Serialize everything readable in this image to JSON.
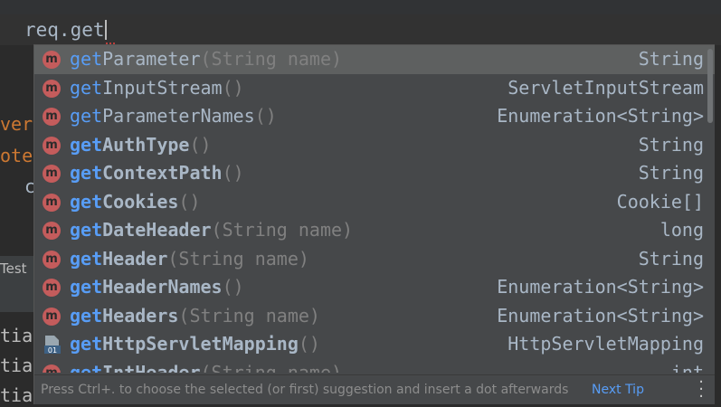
{
  "editor": {
    "code_line": "req.get"
  },
  "background_fragments": [
    "ver",
    "ote",
    "c",
    "Test",
    "tia",
    "tia",
    "tia"
  ],
  "completion": {
    "items": [
      {
        "prefix": "get",
        "rest": "Parameter",
        "params": "(String name)",
        "type": "String",
        "icon": "method-icon",
        "bold": false,
        "selected": true
      },
      {
        "prefix": "get",
        "rest": "InputStream",
        "params": "()",
        "type": "ServletInputStream",
        "icon": "method-icon",
        "bold": false,
        "selected": false
      },
      {
        "prefix": "get",
        "rest": "ParameterNames",
        "params": "()",
        "type": "Enumeration<String>",
        "icon": "method-icon",
        "bold": false,
        "selected": false
      },
      {
        "prefix": "get",
        "rest": "AuthType",
        "params": "()",
        "type": "String",
        "icon": "method-icon",
        "bold": true,
        "selected": false
      },
      {
        "prefix": "get",
        "rest": "ContextPath",
        "params": "()",
        "type": "String",
        "icon": "method-icon",
        "bold": true,
        "selected": false
      },
      {
        "prefix": "get",
        "rest": "Cookies",
        "params": "()",
        "type": "Cookie[]",
        "icon": "method-icon",
        "bold": true,
        "selected": false
      },
      {
        "prefix": "get",
        "rest": "DateHeader",
        "params": "(String name)",
        "type": "long",
        "icon": "method-icon",
        "bold": true,
        "selected": false
      },
      {
        "prefix": "get",
        "rest": "Header",
        "params": "(String name)",
        "type": "String",
        "icon": "method-icon",
        "bold": true,
        "selected": false
      },
      {
        "prefix": "get",
        "rest": "HeaderNames",
        "params": "()",
        "type": "Enumeration<String>",
        "icon": "method-icon",
        "bold": true,
        "selected": false
      },
      {
        "prefix": "get",
        "rest": "Headers",
        "params": "(String name)",
        "type": "Enumeration<String>",
        "icon": "method-icon",
        "bold": true,
        "selected": false
      },
      {
        "prefix": "get",
        "rest": "HttpServletMapping",
        "params": "()",
        "type": "HttpServletMapping",
        "icon": "method-java9-icon",
        "bold": true,
        "selected": false
      },
      {
        "prefix": "get",
        "rest": "IntHeader",
        "params": "(String name)",
        "type": "int",
        "icon": "method-icon",
        "bold": true,
        "selected": false
      }
    ],
    "footer_tip": "Press Ctrl+. to choose the selected (or first) suggestion and insert a dot afterwards",
    "next_tip": "Next Tip"
  },
  "colors": {
    "method_icon": "#c45c5c",
    "match_prefix": "#589df6",
    "selected_row": "#5e6060",
    "popup_bg": "#46484a"
  }
}
